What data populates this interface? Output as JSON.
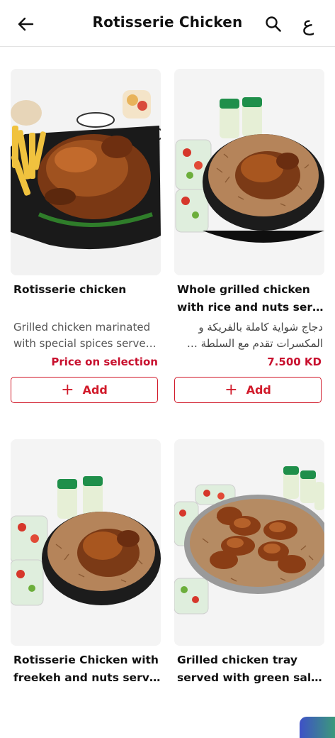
{
  "header": {
    "title": "Rotisserie Chicken",
    "lang_label": "ع"
  },
  "products": [
    {
      "name_line1": "Rotisserie chicken",
      "name_line2": "",
      "desc_line1": "Grilled chicken marinated",
      "desc_line2": "with special spices serve…",
      "price": "Price on selection",
      "add_label": "Add"
    },
    {
      "name_line1": "Whole grilled chicken",
      "name_line2": "with rice and nuts serve…",
      "desc_line1": "دجاج  شواية كاملة بالفريكة و",
      "desc_line2": "المكسرات تقدم مع السلطة …",
      "price": "7.500 KD",
      "add_label": "Add"
    },
    {
      "name_line1": "Rotisserie Chicken with",
      "name_line2": "freekeh and nuts serve…"
    },
    {
      "name_line1": "Grilled chicken tray",
      "name_line2": "served with green sala…"
    }
  ],
  "colors": {
    "accent": "#d11a2a",
    "price": "#c8102e"
  }
}
